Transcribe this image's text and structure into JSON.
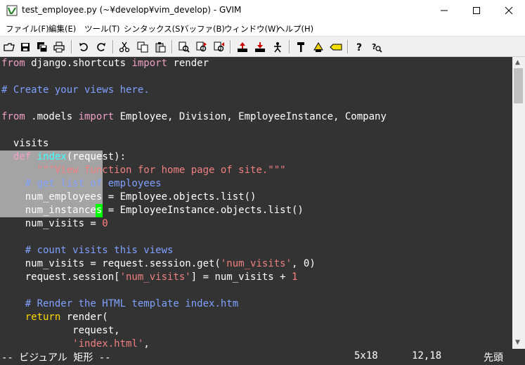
{
  "window": {
    "title": "test_employee.py (~¥develop¥vim_develop) - GVIM",
    "minimize_glyph": "—",
    "maximize_glyph": "☐",
    "close_glyph": "✕"
  },
  "menu": [
    "ファイル(F)",
    "編集(E)",
    "ツール(T)",
    "シンタックス(S)",
    "バッファ(B)",
    "ウィンドウ(W)",
    "ヘルプ(H)"
  ],
  "toolbar": {
    "buttons": [
      "open-icon",
      "save-icon",
      "save-all-icon",
      "print-icon",
      "undo-icon",
      "redo-icon",
      "cut-icon",
      "copy-icon",
      "paste-icon",
      "find-replace-icon",
      "find-next-icon",
      "find-prev-icon",
      "load-session-icon",
      "save-session-icon",
      "run-script-icon",
      "make-icon",
      "shell-icon",
      "ctags-icon",
      "help-icon",
      "find-help-icon"
    ]
  },
  "code": [
    [
      {
        "t": "from",
        "c": "kw"
      },
      {
        "t": " django.shortcuts "
      },
      {
        "t": "import",
        "c": "kw"
      },
      {
        "t": " render"
      }
    ],
    [],
    [
      {
        "t": "# Create your views here.",
        "c": "cm"
      }
    ],
    [],
    [
      {
        "t": "from",
        "c": "kw"
      },
      {
        "t": " .models "
      },
      {
        "t": "import",
        "c": "kw"
      },
      {
        "t": " Employee, Division, EmployeeInstance, Company"
      }
    ],
    [],
    [
      {
        "t": "  visits"
      }
    ],
    [
      {
        "t": "  "
      },
      {
        "t": "def",
        "c": "kw"
      },
      {
        "t": " "
      },
      {
        "t": "index",
        "c": "fn"
      },
      {
        "t": "(request):"
      }
    ],
    [
      {
        "t": "      "
      },
      {
        "t": "\"\"\"View function for home page of site.\"\"\"",
        "c": "st"
      }
    ],
    [
      {
        "t": "    "
      },
      {
        "t": "# get list of employees",
        "c": "cm"
      }
    ],
    [
      {
        "t": "    num_employees = Employee.objects.list()"
      }
    ],
    [
      {
        "t": "    num_instances = EmployeeInstance.objects.list()"
      }
    ],
    [
      {
        "t": "    num_visits = "
      },
      {
        "t": "0",
        "c": "nm"
      }
    ],
    [],
    [
      {
        "t": "    "
      },
      {
        "t": "# count visits this views",
        "c": "cm"
      }
    ],
    [
      {
        "t": "    num_visits = request.session.get("
      },
      {
        "t": "'num_visits'",
        "c": "st"
      },
      {
        "t": ", 0)"
      }
    ],
    [
      {
        "t": "    request.session["
      },
      {
        "t": "'num_visits'",
        "c": "st"
      },
      {
        "t": "] = num_visits + "
      },
      {
        "t": "1",
        "c": "nm"
      }
    ],
    [],
    [
      {
        "t": "    "
      },
      {
        "t": "# Render the HTML template index.htm",
        "c": "cm"
      }
    ],
    [
      {
        "t": "    "
      },
      {
        "t": "return",
        "c": "kw2"
      },
      {
        "t": " render("
      }
    ],
    [
      {
        "t": "            request,"
      }
    ],
    [
      {
        "t": "            "
      },
      {
        "t": "'index.html'",
        "c": "st"
      },
      {
        "t": ","
      }
    ]
  ],
  "status": {
    "mode": "-- ビジュアル 矩形 --",
    "selection_size": "5x18",
    "position": "12,18",
    "scroll": "先頭"
  },
  "colors": {
    "editor_bg": "#333333",
    "keyword": "#f0a0c0",
    "comment": "#80a0ff",
    "string": "#f08080",
    "cursor": "#00ff00",
    "visual_selection": "#b9b9b9"
  }
}
